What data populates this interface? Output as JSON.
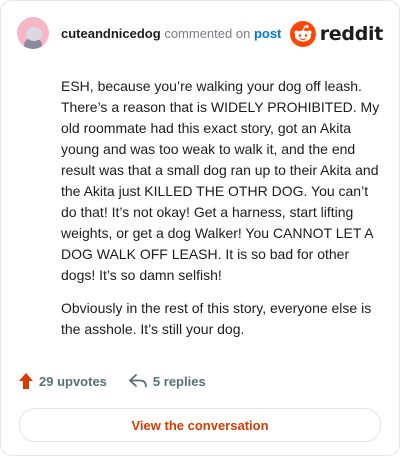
{
  "header": {
    "username": "cuteandnicedog",
    "commented_on": "commented on",
    "post_link": "post",
    "brand": "reddit"
  },
  "comment": {
    "paragraphs": [
      "ESH, because you’re walking your dog off leash. There’s a reason that is WIDELY PROHIBITED. My old roommate had this exact story, got an Akita young and was too weak to walk it, and the end result was that a small dog ran up to their Akita and the Akita just KILLED THE OTHR DOG. You can’t do that! It’s not okay! Get a harness, start lifting weights, or get a dog Walker! You CANNOT LET A DOG WALK OFF LEASH. It is so bad for other dogs! It’s so damn selfish!",
      "Obviously in the rest of this story, everyone else is the asshole. It’s still your dog."
    ]
  },
  "actions": {
    "upvotes": "29 upvotes",
    "replies": "5 replies"
  },
  "cta": {
    "label": "View the conversation"
  },
  "colors": {
    "brand_orange": "#ff4500",
    "upvote_orange": "#d93a00",
    "link_blue": "#0079d3",
    "muted": "#576f76"
  },
  "icons": {
    "avatar": "snoo-avatar",
    "brand": "reddit-snoo-logo",
    "upvote": "upvote-arrow-icon",
    "reply": "reply-arrow-icon"
  }
}
